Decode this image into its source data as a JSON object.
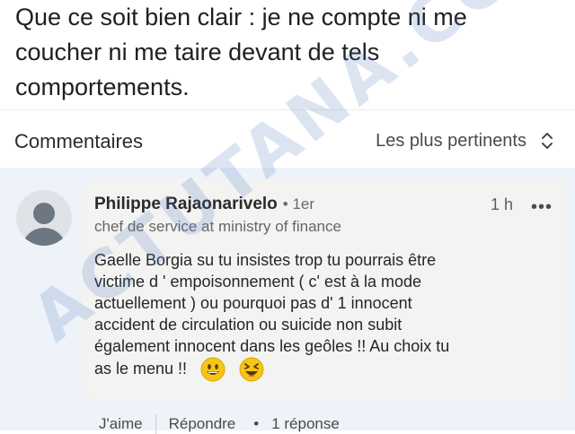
{
  "post": {
    "lines": [
      "Que ce soit bien clair : je ne compte ni me",
      "coucher ni me taire devant de tels",
      "comportements."
    ]
  },
  "comments_section": {
    "title": "Commentaires",
    "sort_label": "Les plus pertinents",
    "sort_icon": "sort-updown-icon"
  },
  "comment": {
    "author": "Philippe Rajaonarivelo",
    "degree": "• 1er",
    "time": "1 h",
    "more_label": "•••",
    "headline": "chef de service at ministry of finance",
    "text_lines": [
      "Gaelle Borgia su tu insistes trop tu pourrais être",
      "victime d ' empoisonnement ( c' est à la mode",
      "actuellement ) ou pourquoi pas d' 1 innocent",
      "accident de circulation ou suicide non subit",
      "également innocent dans les geôles  !! Au choix tu",
      "as le menu !!"
    ],
    "emojis": [
      "grinning-face-emoji",
      "laughing-squint-emoji"
    ],
    "actions": {
      "like": "J'aime",
      "reply": "Répondre",
      "replies": "1 réponse"
    }
  },
  "watermark": "ACTUTANA.COM",
  "colors": {
    "comment_bg": "#eef3f9",
    "bubble_bg": "#f3f3f2",
    "emoji_yellow": "#f5c518"
  }
}
